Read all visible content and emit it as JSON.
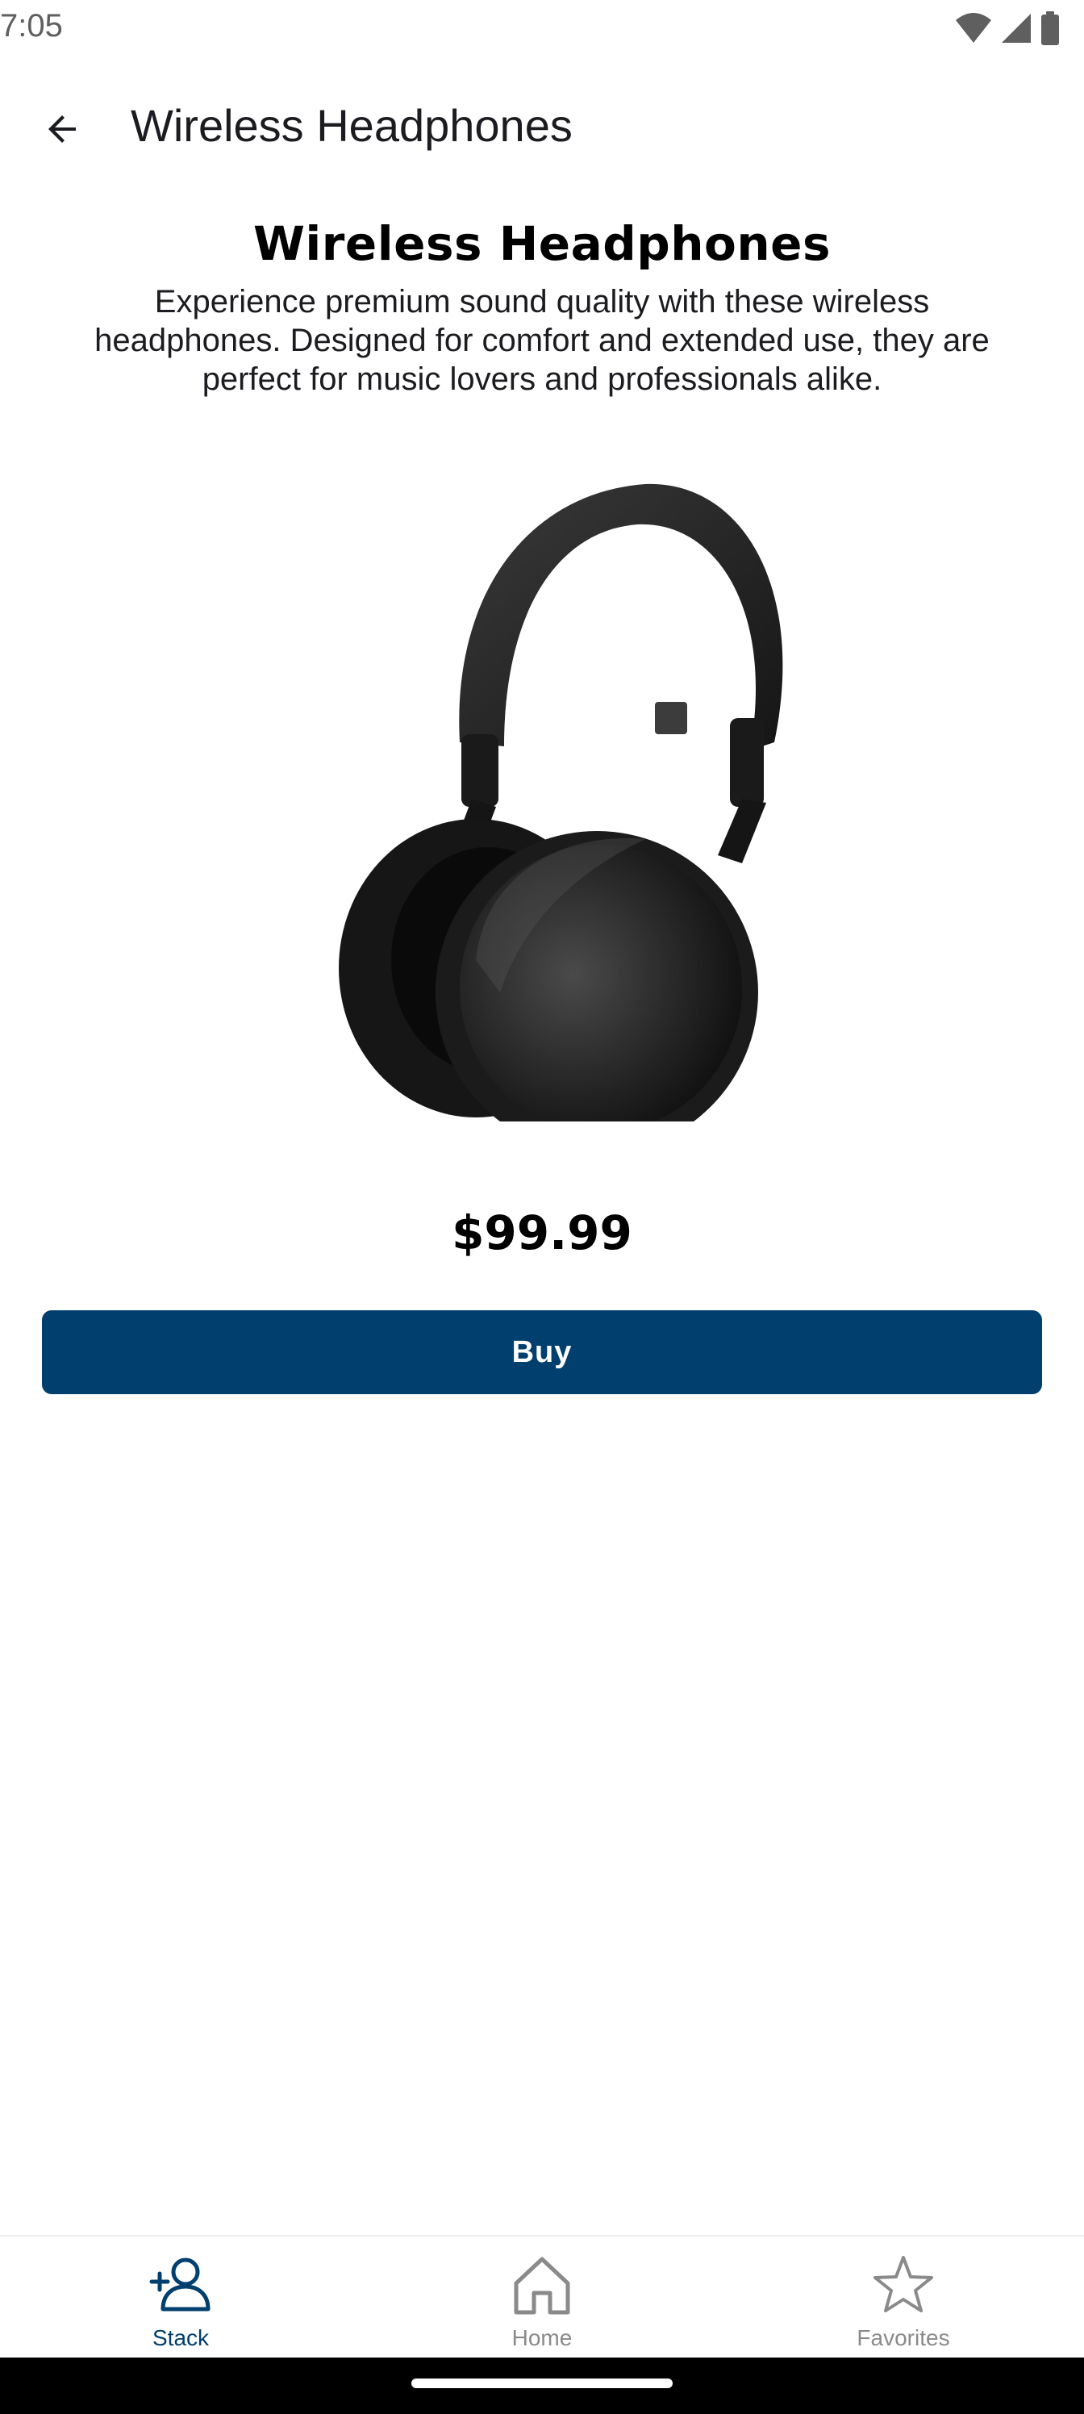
{
  "status_bar": {
    "time": "7:05",
    "icons": [
      "wifi-icon",
      "signal-icon",
      "battery-icon"
    ]
  },
  "top_bar": {
    "title": "Wireless Headphones",
    "back_icon": "arrow-back-icon"
  },
  "product": {
    "title": "Wireless Headphones",
    "description": "Experience premium sound quality with these wireless headphones. Designed for comfort and extended use, they are perfect for music lovers and professionals alike.",
    "price": "$99.99",
    "buy_label": "Buy"
  },
  "bottom_nav": {
    "items": [
      {
        "label": "Stack",
        "icon": "person-add-icon",
        "active": true
      },
      {
        "label": "Home",
        "icon": "home-icon",
        "active": false
      },
      {
        "label": "Favorites",
        "icon": "star-icon",
        "active": false
      }
    ]
  },
  "colors": {
    "accent": "#003f6e",
    "inactive": "#8a8a8a",
    "text": "#1c1b1f"
  }
}
